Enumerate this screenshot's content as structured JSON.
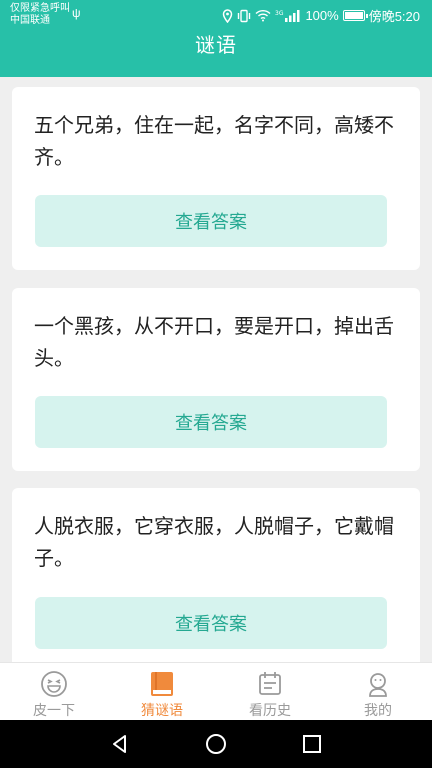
{
  "status_bar": {
    "carrier_line1": "仅限紧急呼叫",
    "carrier_line2": "中国联通",
    "battery_percent": "100%",
    "time": "傍晚5:20"
  },
  "header": {
    "title": "谜语"
  },
  "riddles": [
    {
      "question": "五个兄弟，住在一起，名字不同，高矮不齐。",
      "button_label": "查看答案"
    },
    {
      "question": "一个黑孩，从不开口，要是开口，掉出舌头。",
      "button_label": "查看答案"
    },
    {
      "question": "人脱衣服，它穿衣服，人脱帽子，它戴帽子。",
      "button_label": "查看答案"
    }
  ],
  "tabs": [
    {
      "label": "皮一下",
      "icon": "laughing-face-icon",
      "active": false
    },
    {
      "label": "猜谜语",
      "icon": "book-icon",
      "active": true
    },
    {
      "label": "看历史",
      "icon": "calendar-icon",
      "active": false
    },
    {
      "label": "我的",
      "icon": "profile-icon",
      "active": false
    }
  ],
  "colors": {
    "header": "#27c0a8",
    "button_bg": "#d6f3ee",
    "button_text": "#24a891",
    "tab_active": "#f08a3c",
    "tab_inactive": "#9a9a9a"
  }
}
